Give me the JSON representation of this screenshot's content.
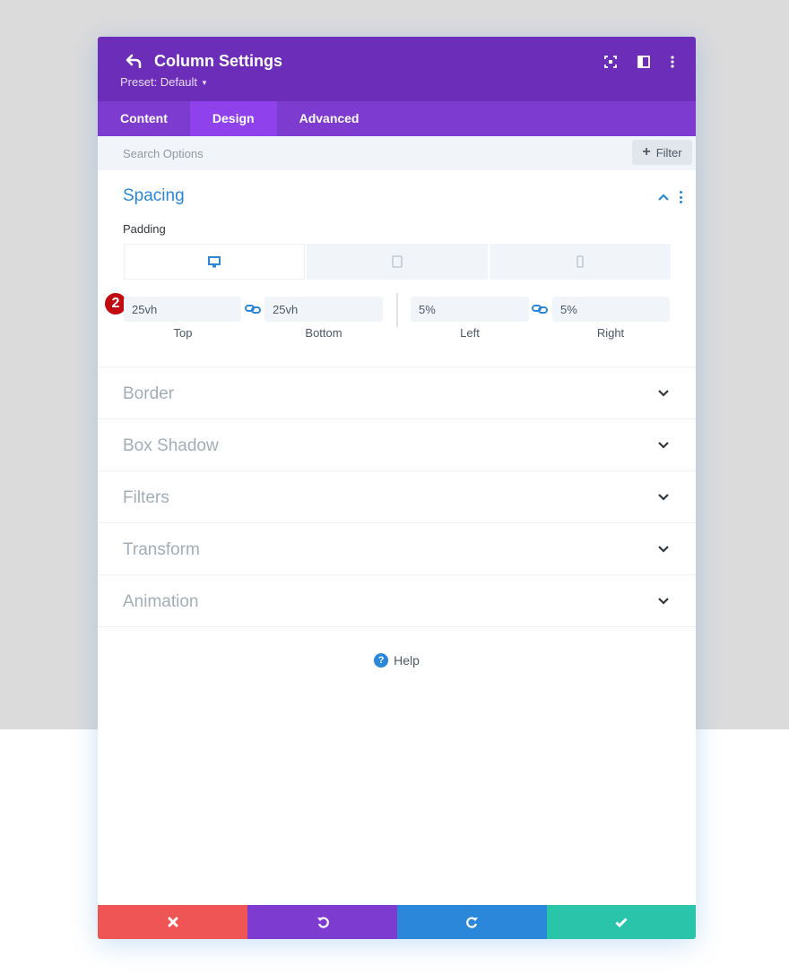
{
  "header": {
    "title": "Column Settings",
    "preset_label": "Preset: Default",
    "background": "#6c2eb9"
  },
  "tabs": [
    {
      "label": "Content",
      "active": false
    },
    {
      "label": "Design",
      "active": true
    },
    {
      "label": "Advanced",
      "active": false
    }
  ],
  "search": {
    "placeholder": "Search Options",
    "filter_label": "Filter"
  },
  "spacing": {
    "title": "Spacing",
    "padding_label": "Padding",
    "devices": [
      "desktop-icon",
      "tablet-icon",
      "phone-icon"
    ],
    "active_device": "desktop",
    "badge": "2",
    "fields": {
      "top": {
        "value": "25vh",
        "label": "Top"
      },
      "bottom": {
        "value": "25vh",
        "label": "Bottom"
      },
      "left": {
        "value": "5%",
        "label": "Left"
      },
      "right": {
        "value": "5%",
        "label": "Right"
      }
    }
  },
  "sections": [
    {
      "title": "Border"
    },
    {
      "title": "Box Shadow"
    },
    {
      "title": "Filters"
    },
    {
      "title": "Transform"
    },
    {
      "title": "Animation"
    }
  ],
  "help_label": "Help",
  "footer": {
    "cancel_color": "#ef5555",
    "undo_color": "#7e3bd0",
    "redo_color": "#2b87da",
    "save_color": "#29c4a9"
  },
  "colors": {
    "accent": "#2b87da",
    "tab_bar": "#7e3bd0",
    "tab_active": "#8f42ec",
    "badge": "#c10b11"
  }
}
